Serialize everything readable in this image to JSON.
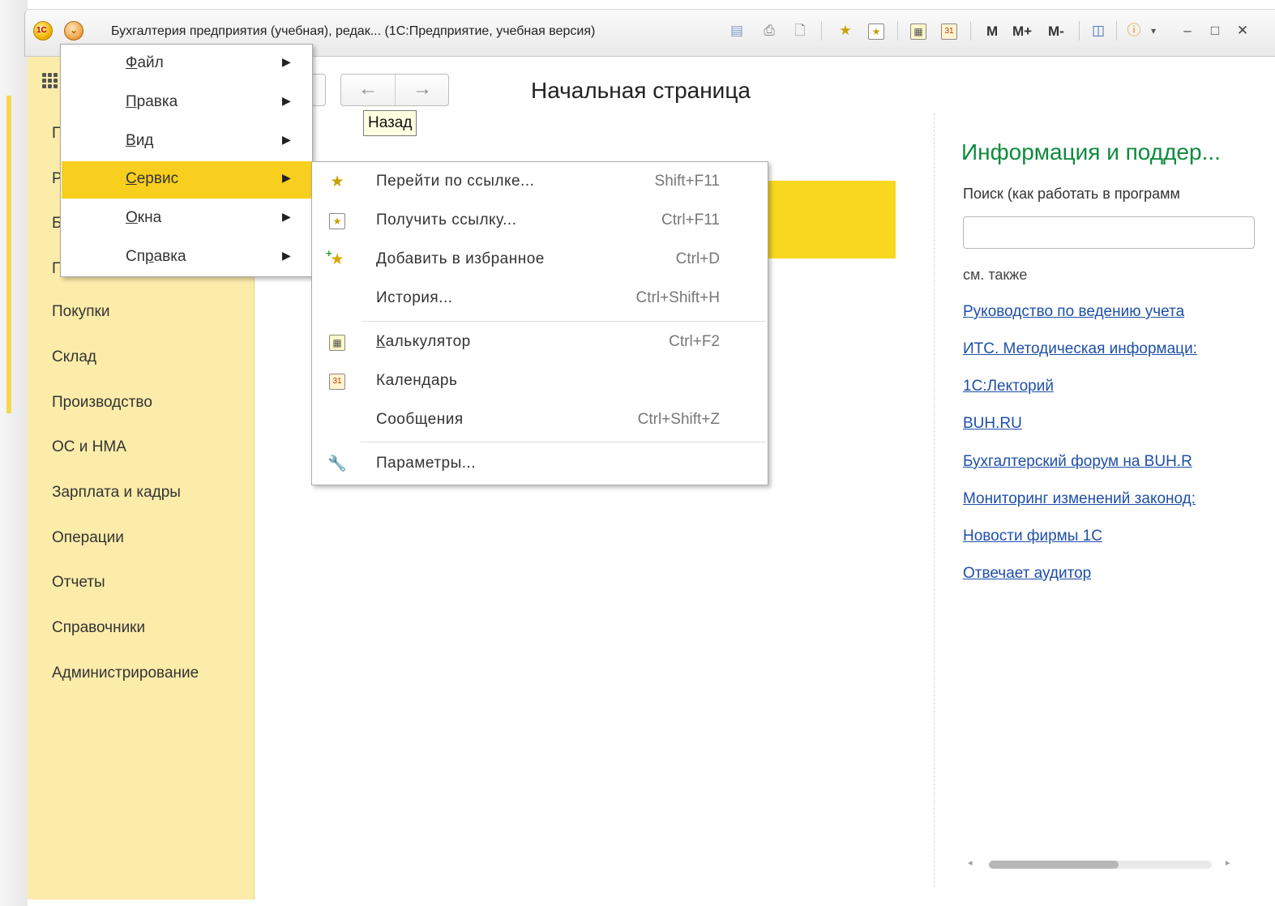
{
  "window": {
    "title": "Бухгалтерия предприятия (учебная), редак... (1С:Предприятие, учебная версия)",
    "toolbar_m": "M",
    "toolbar_mplus": "M+",
    "toolbar_mminus": "M-",
    "calendar_day": "31",
    "logo_text": "1С"
  },
  "main_menu": {
    "items": [
      {
        "label": "Файл",
        "accel": "Ф",
        "rest": "айл"
      },
      {
        "label": "Правка",
        "accel": "П",
        "rest": "равка"
      },
      {
        "label": "Вид",
        "accel": "В",
        "rest": "ид"
      },
      {
        "label": "Сервис",
        "accel": "С",
        "rest": "ервис"
      },
      {
        "label": "Окна",
        "accel": "О",
        "rest": "кна"
      },
      {
        "label": "Справка",
        "pre": "Сп",
        "accel": "р",
        "rest": "авка"
      }
    ],
    "active_item": "Сервис"
  },
  "service_menu": {
    "items": [
      {
        "label": "Перейти по ссылке...",
        "shortcut": "Shift+F11",
        "icon": "star-arrow-icon"
      },
      {
        "label": "Получить ссылку...",
        "shortcut": "Ctrl+F11",
        "icon": "star-link-icon"
      },
      {
        "label": "Добавить в избранное",
        "shortcut": "Ctrl+D",
        "icon": "add-star-icon"
      },
      {
        "label": "История...",
        "shortcut": "Ctrl+Shift+H",
        "icon": ""
      },
      {
        "label": "Калькулятор",
        "accel": "К",
        "rest": "алькулятор",
        "shortcut": "Ctrl+F2",
        "icon": "calculator-icon"
      },
      {
        "label": "Календарь",
        "shortcut": "",
        "icon": "calendar-icon"
      },
      {
        "label": "Сообщения",
        "shortcut": "Ctrl+Shift+Z",
        "icon": ""
      },
      {
        "label": "Параметры...",
        "shortcut": "",
        "icon": "wrench-icon"
      }
    ]
  },
  "toolbar": {
    "back_tooltip": "Назад",
    "back_arrow": "←",
    "forward_arrow": "→"
  },
  "page": {
    "title": "Начальная страница"
  },
  "sidebar": {
    "hidden_initials": [
      "Г",
      "Р",
      "Б",
      "Г"
    ],
    "items": [
      "Покупки",
      "Склад",
      "Производство",
      "ОС и НМА",
      "Зарплата и кадры",
      "Операции",
      "Отчеты",
      "Справочники",
      "Администрирование"
    ]
  },
  "info_panel": {
    "title": "Информация и поддер...",
    "search_label": "Поиск (как работать в программ",
    "search_value": "",
    "see_also": "см. также",
    "links": [
      "Руководство по ведению учета",
      "ИТС. Методическая информаци:",
      "1С:Лекторий",
      "BUH.RU",
      "Бухгалтерский форум на BUH.R",
      "Мониторинг изменений законод:",
      "Новости фирмы 1С",
      "Отвечает аудитор"
    ]
  },
  "colors": {
    "menu_highlight": "#f8cf1e",
    "sidebar_bg": "#fcecaa",
    "info_title": "#0e8a3e",
    "link": "#1f4fa8"
  }
}
